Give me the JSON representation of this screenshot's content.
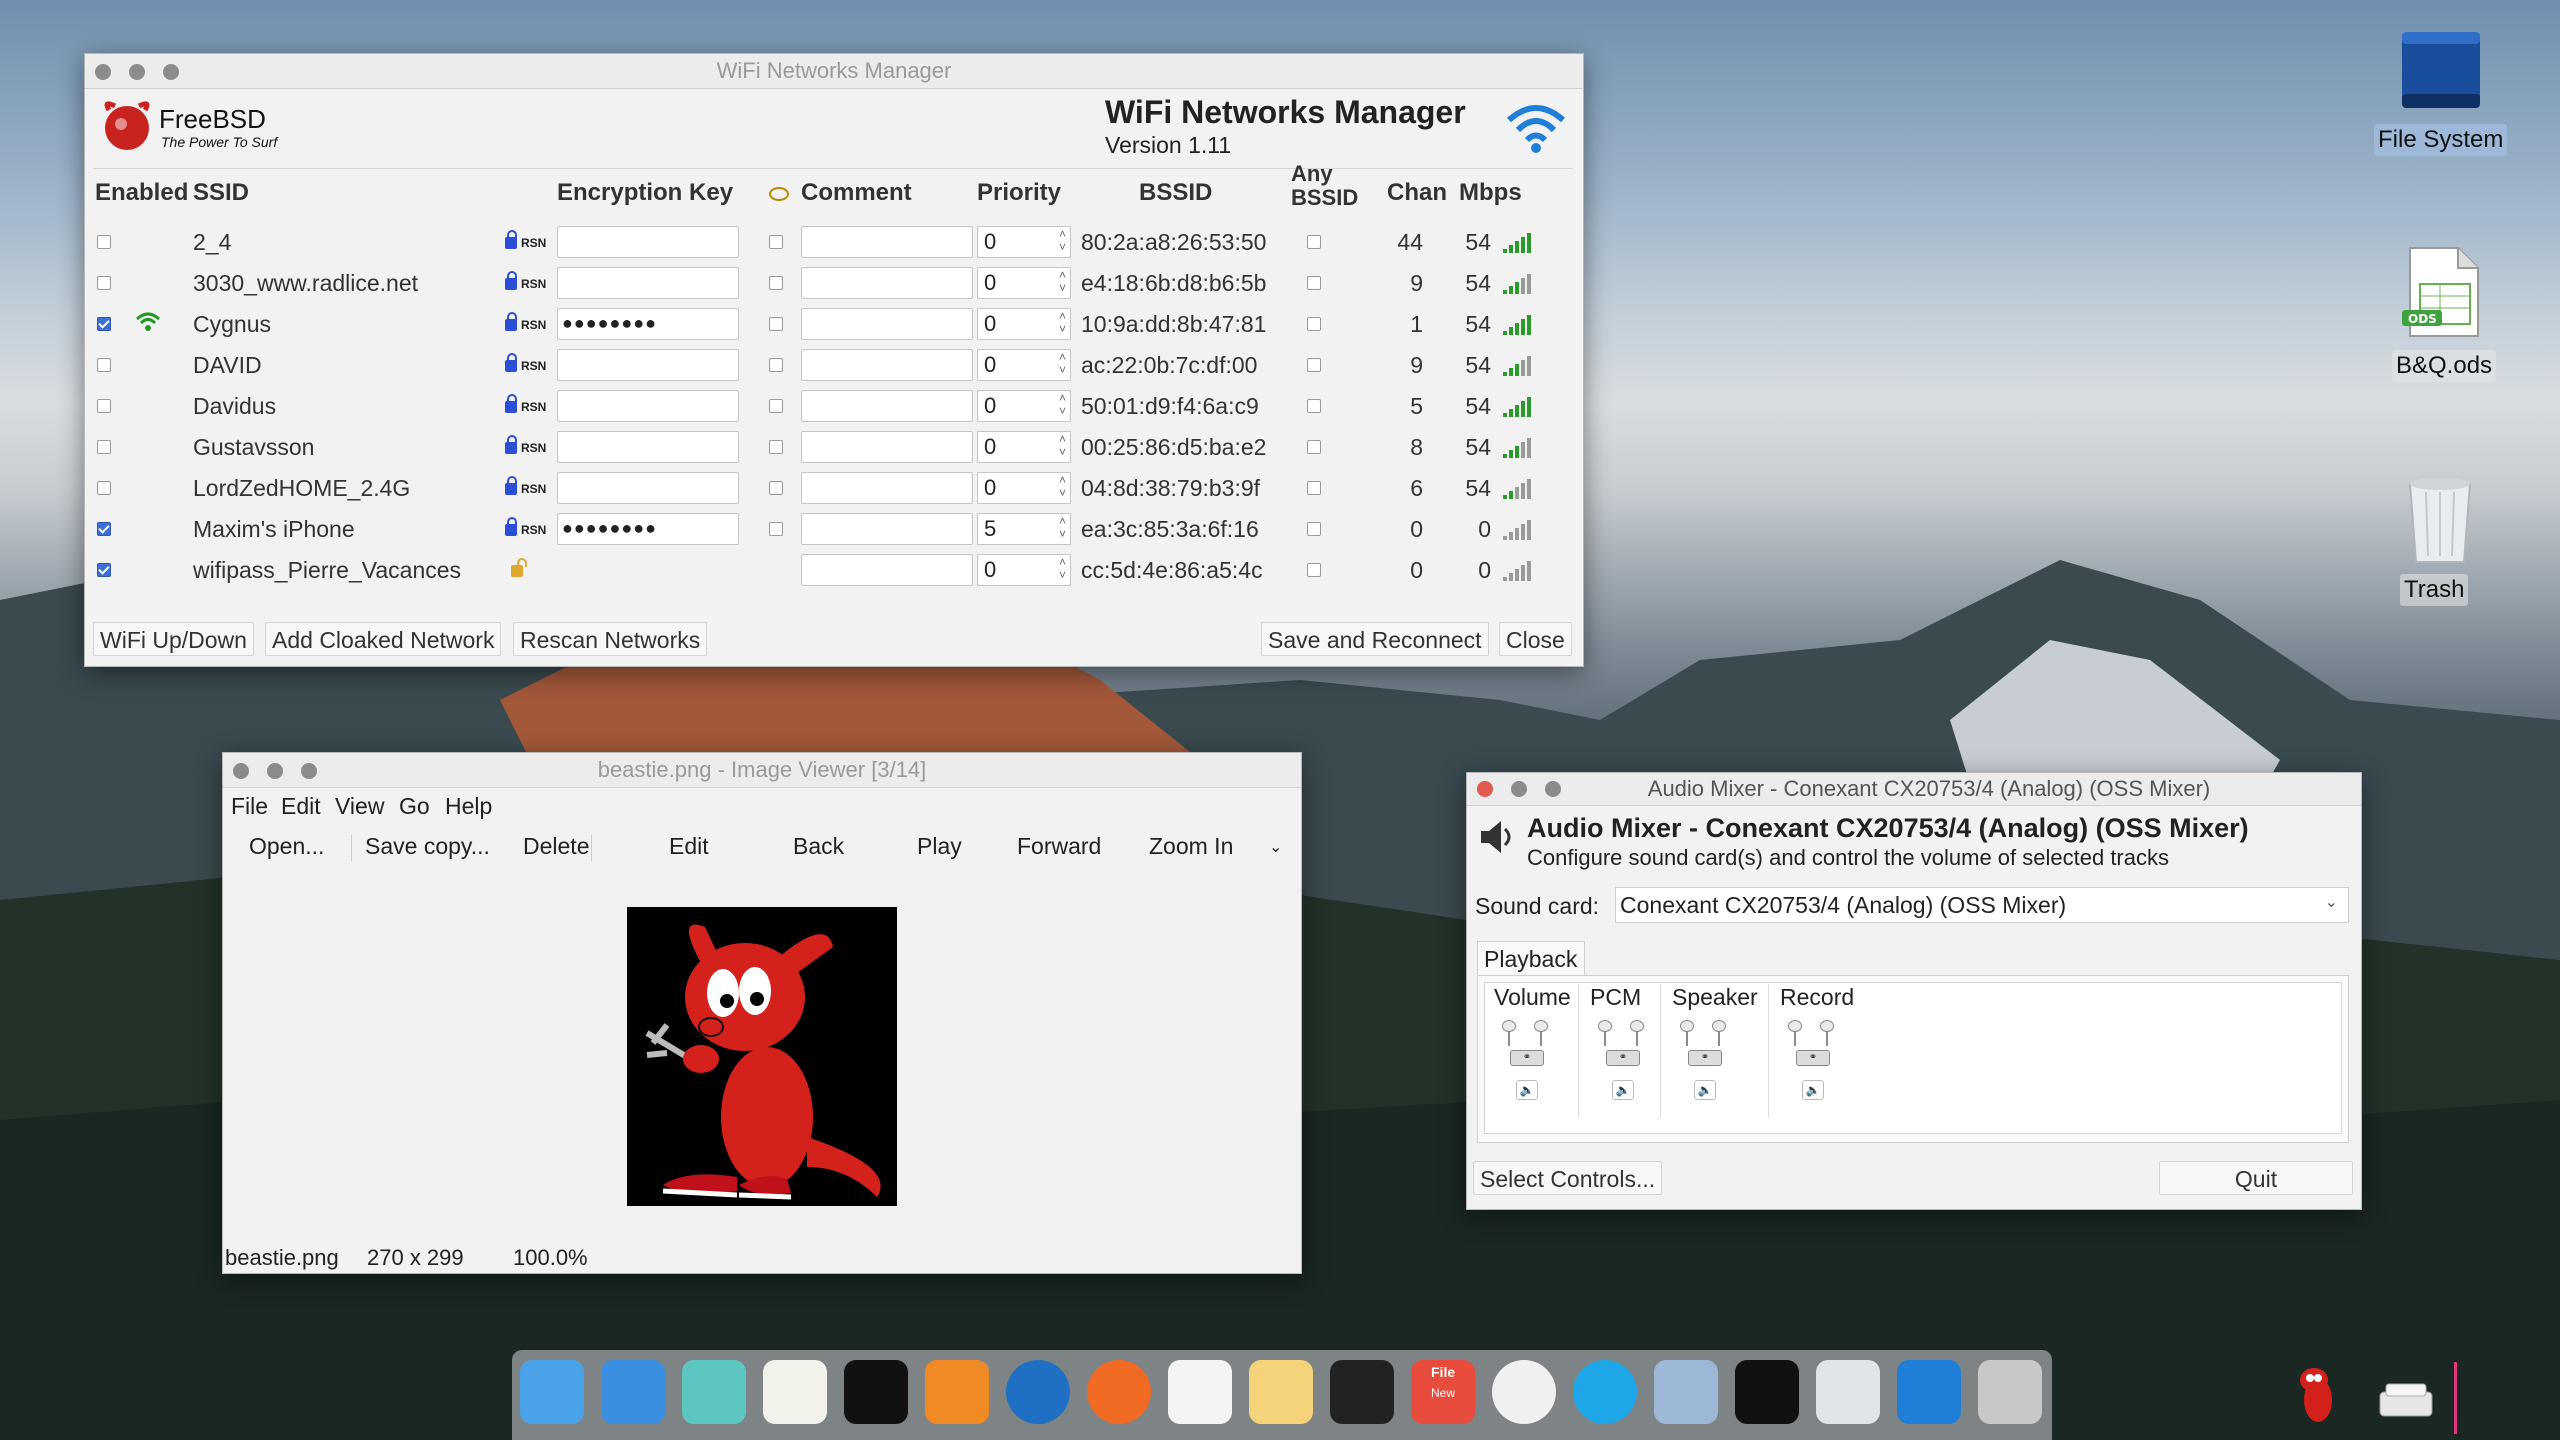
{
  "wifi": {
    "title": "WiFi Networks Manager",
    "logo_text": "FreeBSD",
    "logo_tagline": "The Power To Surf",
    "header_title": "WiFi Networks Manager",
    "version": "Version 1.11",
    "columns": {
      "enabled": "Enabled",
      "ssid": "SSID",
      "key": "Encryption Key",
      "comment": "Comment",
      "priority": "Priority",
      "bssid": "BSSID",
      "any1": "Any",
      "any2": "BSSID",
      "chan": "Chan",
      "mbps": "Mbps"
    },
    "rows": [
      {
        "enabled": false,
        "connected": false,
        "ssid": "2_4",
        "sec": "RSN",
        "key": "",
        "priority": "0",
        "bssid": "80:2a:a8:26:53:50",
        "chan": "44",
        "mbps": "54",
        "signal": 5
      },
      {
        "enabled": false,
        "connected": false,
        "ssid": "3030_www.radlice.net",
        "sec": "RSN",
        "key": "",
        "priority": "0",
        "bssid": "e4:18:6b:d8:b6:5b",
        "chan": "9",
        "mbps": "54",
        "signal": 3
      },
      {
        "enabled": true,
        "connected": true,
        "ssid": "Cygnus",
        "sec": "RSN",
        "key": "●●●●●●●●",
        "priority": "0",
        "bssid": "10:9a:dd:8b:47:81",
        "chan": "1",
        "mbps": "54",
        "signal": 5
      },
      {
        "enabled": false,
        "connected": false,
        "ssid": "DAVID",
        "sec": "RSN",
        "key": "",
        "priority": "0",
        "bssid": "ac:22:0b:7c:df:00",
        "chan": "9",
        "mbps": "54",
        "signal": 3
      },
      {
        "enabled": false,
        "connected": false,
        "ssid": "Davidus",
        "sec": "RSN",
        "key": "",
        "priority": "0",
        "bssid": "50:01:d9:f4:6a:c9",
        "chan": "5",
        "mbps": "54",
        "signal": 5
      },
      {
        "enabled": false,
        "connected": false,
        "ssid": "Gustavsson",
        "sec": "RSN",
        "key": "",
        "priority": "0",
        "bssid": "00:25:86:d5:ba:e2",
        "chan": "8",
        "mbps": "54",
        "signal": 3
      },
      {
        "enabled": false,
        "connected": false,
        "ssid": "LordZedHOME_2.4G",
        "sec": "RSN",
        "key": "",
        "priority": "0",
        "bssid": "04:8d:38:79:b3:9f",
        "chan": "6",
        "mbps": "54",
        "signal": 2
      },
      {
        "enabled": true,
        "connected": false,
        "ssid": "Maxim's iPhone",
        "sec": "RSN",
        "key": "●●●●●●●●",
        "priority": "5",
        "bssid": "ea:3c:85:3a:6f:16",
        "chan": "0",
        "mbps": "0",
        "signal": 0
      },
      {
        "enabled": true,
        "connected": false,
        "ssid": "wifipass_Pierre_Vacances",
        "sec": "",
        "key": "",
        "priority": "0",
        "bssid": "cc:5d:4e:86:a5:4c",
        "chan": "0",
        "mbps": "0",
        "signal": 0
      }
    ],
    "buttons": {
      "updown": "WiFi Up/Down",
      "cloaked": "Add Cloaked Network",
      "rescan": "Rescan Networks",
      "save": "Save and Reconnect",
      "close": "Close"
    }
  },
  "viewer": {
    "title": "beastie.png - Image Viewer [3/14]",
    "menu": [
      "File",
      "Edit",
      "View",
      "Go",
      "Help"
    ],
    "toolbar": [
      "Open...",
      "Save copy...",
      "Delete",
      "Edit",
      "Back",
      "Play",
      "Forward",
      "Zoom In"
    ],
    "status_file": "beastie.png",
    "status_size": "270 x 299",
    "status_zoom": "100.0%"
  },
  "mixer": {
    "title": "Audio Mixer - Conexant CX20753/4 (Analog) (OSS Mixer)",
    "heading": "Audio Mixer - Conexant CX20753/4 (Analog) (OSS Mixer)",
    "subheading": "Configure sound card(s) and control the volume of selected tracks",
    "card_label": "Sound card:",
    "card_value": "Conexant CX20753/4 (Analog) (OSS Mixer)",
    "tab": "Playback",
    "tracks": [
      "Volume",
      "PCM",
      "Speaker",
      "Record"
    ],
    "select_controls": "Select Controls...",
    "quit": "Quit"
  },
  "desktop": {
    "icons": [
      "File System",
      "B&Q.ods",
      "Trash"
    ],
    "ods_badge": "ODS"
  },
  "dock_icons": [
    "finder-icon",
    "mail-icon",
    "files-icon",
    "text-editor-icon",
    "terminal-icon",
    "calculator-icon",
    "browser-icon",
    "firefox-icon",
    "charts-icon",
    "notes-icon",
    "system-monitor-icon",
    "file-new-icon",
    "clock-icon",
    "skype-icon",
    "image-viewer-icon",
    "text-file-icon",
    "trash-icon",
    "wifi-icon",
    "audio-icon"
  ],
  "dock_labels": {
    "file_new_top": "File",
    "file_new_bottom": "New"
  }
}
